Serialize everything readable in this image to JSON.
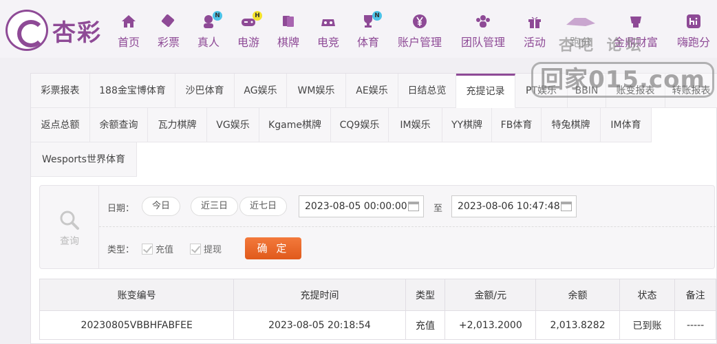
{
  "brand": {
    "name": "杏彩"
  },
  "nav": [
    {
      "label": "首页",
      "icon": "home-icon",
      "badge": ""
    },
    {
      "label": "彩票",
      "icon": "lottery-ticket-icon",
      "badge": ""
    },
    {
      "label": "真人",
      "icon": "live-dealer-icon",
      "badge": "N"
    },
    {
      "label": "电游",
      "icon": "gamepad-icon",
      "badge": "H"
    },
    {
      "label": "棋牌",
      "icon": "cards-icon",
      "badge": ""
    },
    {
      "label": "电竞",
      "icon": "esports-controller-icon",
      "badge": ""
    },
    {
      "label": "体育",
      "icon": "trophy-icon",
      "badge": "N"
    },
    {
      "label": "账户管理",
      "icon": "yen-coin-icon",
      "badge": ""
    },
    {
      "label": "团队管理",
      "icon": "team-icon",
      "badge": ""
    },
    {
      "label": "活动",
      "icon": "gift-icon",
      "badge": ""
    },
    {
      "label": "跑分",
      "icon": "running-icon",
      "badge": ""
    },
    {
      "label": "金鼎财富",
      "icon": "wealth-icon",
      "badge": ""
    },
    {
      "label": "嗨跑分",
      "icon": "hi-icon",
      "badge": ""
    }
  ],
  "watermark": {
    "top": "杏吧 论坛",
    "main": "回家015.com"
  },
  "tabs": [
    "彩票报表",
    "188金宝博体育",
    "沙巴体育",
    "AG娱乐",
    "WM娱乐",
    "AE娱乐",
    "日结总览",
    "充提记录",
    "PT娱乐",
    "BBIN",
    "账变报表",
    "转账报表",
    "返点总额",
    "余额查询",
    "瓦力棋牌",
    "VG娱乐",
    "Kgame棋牌",
    "CQ9娱乐",
    "IM娱乐",
    "YY棋牌",
    "FB体育",
    "特兔棋牌",
    "IM体育",
    "Wesports世界体育"
  ],
  "active_tab": "充提记录",
  "search": {
    "side_label": "查询",
    "date_label": "日期：",
    "quick_ranges": [
      "今日",
      "近三日",
      "近七日"
    ],
    "start_date": "2023-08-05 00:00:00",
    "to_label": "至",
    "end_date": "2023-08-06 10:47:48",
    "type_label": "类型：",
    "type_options": [
      "充值",
      "提现"
    ],
    "confirm_label": "确 定"
  },
  "table": {
    "headers": [
      "账变编号",
      "充提时间",
      "类型",
      "金额/元",
      "余额",
      "状态",
      "备注"
    ],
    "rows": [
      [
        "20230805VBBHFABFEE",
        "2023-08-05 20:18:54",
        "充值",
        "+2,013.2000",
        "2,013.8282",
        "已到账",
        "-----"
      ]
    ]
  },
  "colors": {
    "brand": "#8e4a96",
    "accent": "#e8621f",
    "positive": "#d23a3a",
    "status_ok": "#3aa33a"
  }
}
